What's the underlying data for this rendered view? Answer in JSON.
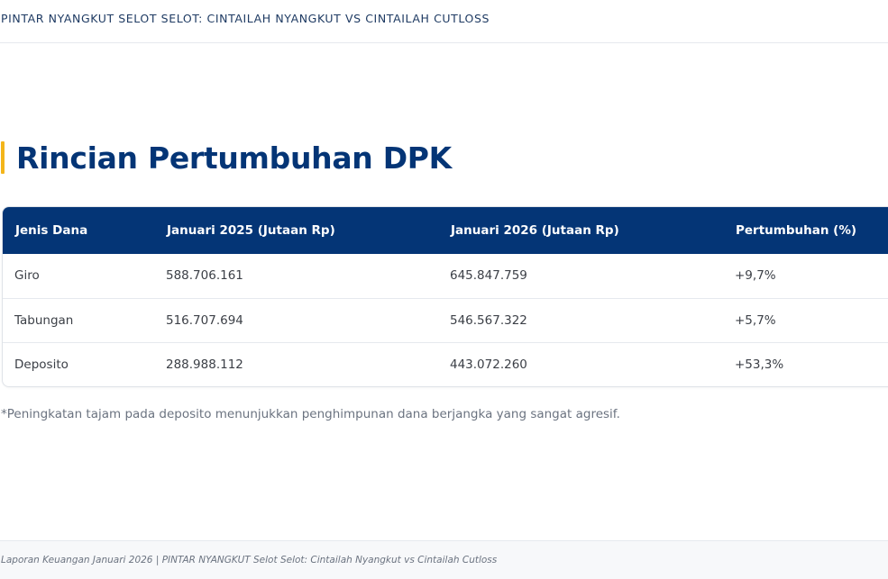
{
  "header": {
    "title": "PINTAR NYANGKUT SELOT SELOT: CINTAILAH NYANGKUT VS CINTAILAH CUTLOSS"
  },
  "section": {
    "heading": "Rincian Pertumbuhan DPK"
  },
  "table": {
    "columns": [
      "Jenis Dana",
      "Januari 2025 (Jutaan Rp)",
      "Januari 2026 (Jutaan Rp)",
      "Pertumbuhan (%)"
    ],
    "rows": [
      [
        "Giro",
        "588.706.161",
        "645.847.759",
        "+9,7%"
      ],
      [
        "Tabungan",
        "516.707.694",
        "546.567.322",
        "+5,7%"
      ],
      [
        "Deposito",
        "288.988.112",
        "443.072.260",
        "+53,3%"
      ]
    ]
  },
  "note": "*Peningkatan tajam pada deposito menunjukkan penghimpunan dana berjangka yang sangat agresif.",
  "footer": {
    "text": "Laporan Keuangan Januari 2026 | PINTAR NYANGKUT Selot Selot: Cintailah Nyangkut vs Cintailah Cutloss"
  },
  "colors": {
    "primary": "#043576",
    "accent": "#f3b51b",
    "text": "#3b3f46",
    "muted": "#6b7380"
  }
}
